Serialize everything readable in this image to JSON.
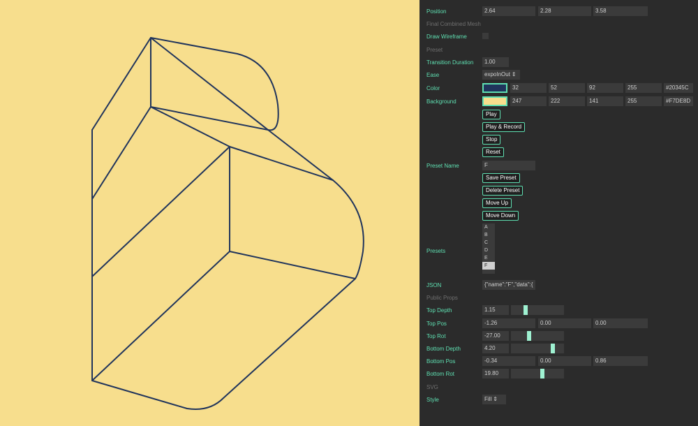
{
  "colors": {
    "line": "#20345C",
    "background": "#F7DE8D",
    "accent": "#5fe0b2"
  },
  "position": {
    "label": "Position",
    "values": [
      "2.64",
      "2.28",
      "3.58"
    ]
  },
  "final_mesh_label": "Final Combined Mesh",
  "draw_wireframe_label": "Draw Wireframe",
  "preset_section": "Preset",
  "transition": {
    "label": "Transition Duration",
    "value": "1.00"
  },
  "ease": {
    "label": "Ease",
    "value": "expoInOut",
    "icon": "updown-arrows-icon"
  },
  "color": {
    "label": "Color",
    "values": [
      "32",
      "52",
      "92",
      "255",
      "#20345C"
    ]
  },
  "background": {
    "label": "Background",
    "values": [
      "247",
      "222",
      "141",
      "255",
      "#F7DE8D"
    ]
  },
  "buttons": {
    "play": "Play",
    "play_record": "Play & Record",
    "stop": "Stop",
    "reset": "Reset",
    "save_preset": "Save Preset",
    "delete_preset": "Delete Preset",
    "move_up": "Move Up",
    "move_down": "Move Down"
  },
  "preset_name": {
    "label": "Preset Name",
    "value": "F"
  },
  "presets": {
    "label": "Presets",
    "items": [
      "A",
      "B",
      "C",
      "D",
      "E",
      "F"
    ],
    "selected": "F"
  },
  "json": {
    "label": "JSON",
    "value": "{\"name\":\"F\",\"data\":{"
  },
  "public_props": "Public Props",
  "top_depth": {
    "label": "Top Depth",
    "value": "1.15",
    "level": 0.25
  },
  "top_pos": {
    "label": "Top Pos",
    "values": [
      "-1.26",
      "0.00",
      "0.00"
    ]
  },
  "top_rot": {
    "label": "Top Rot",
    "value": "-27.00",
    "level": 0.33
  },
  "bottom_depth": {
    "label": "Bottom Depth",
    "value": "4.20",
    "level": 0.82
  },
  "bottom_pos": {
    "label": "Bottom Pos",
    "values": [
      "-0.34",
      "0.00",
      "0.86"
    ]
  },
  "bottom_rot": {
    "label": "Bottom Rot",
    "value": "19.80",
    "level": 0.6
  },
  "svg_section": "SVG",
  "style": {
    "label": "Style",
    "value": "Fill",
    "icon": "updown-arrows-icon"
  }
}
